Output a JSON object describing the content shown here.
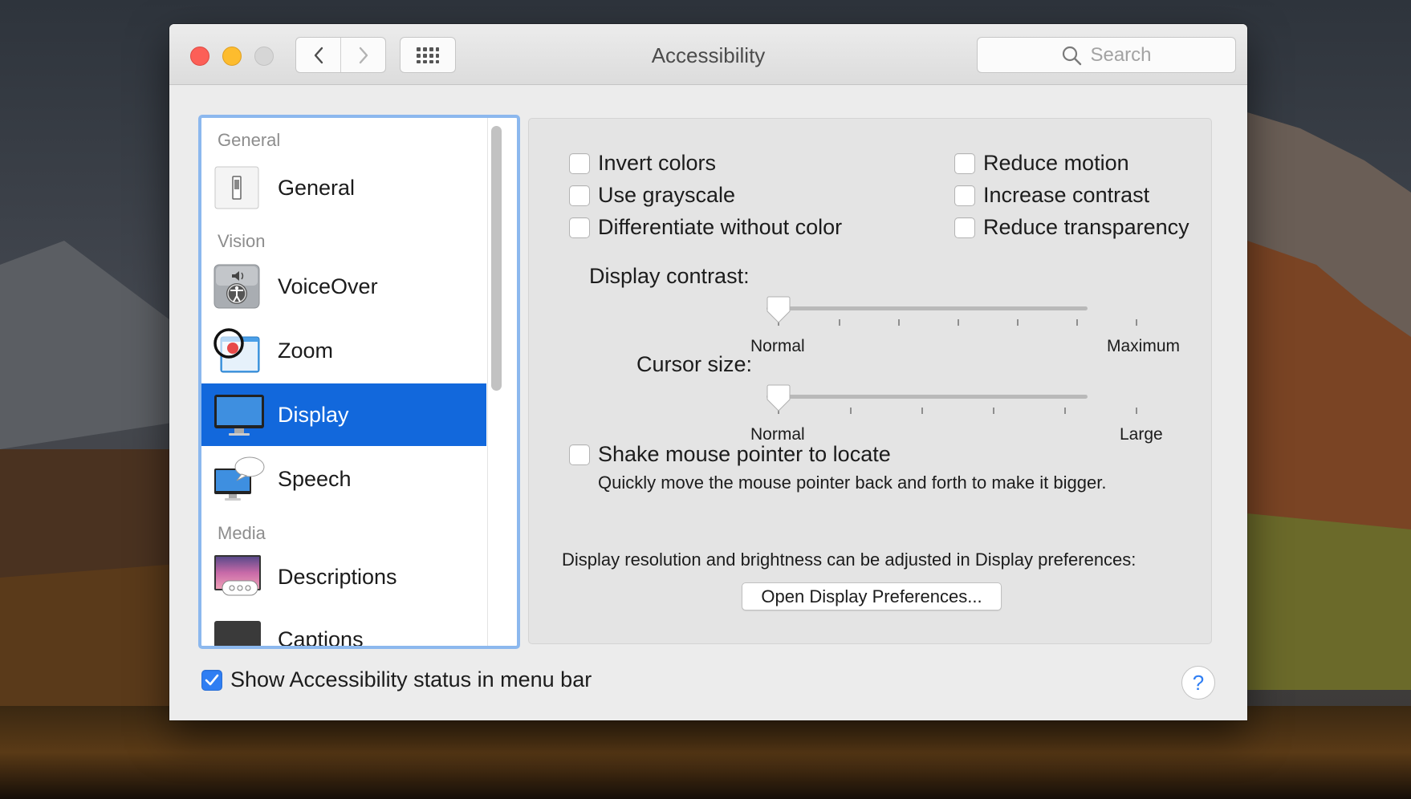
{
  "window": {
    "title": "Accessibility",
    "search_placeholder": "Search"
  },
  "sidebar": {
    "sections": [
      {
        "header": "General",
        "items": [
          {
            "label": "General",
            "icon": "switch-icon"
          }
        ]
      },
      {
        "header": "Vision",
        "items": [
          {
            "label": "VoiceOver",
            "icon": "voiceover-icon"
          },
          {
            "label": "Zoom",
            "icon": "zoom-magnifier-icon"
          },
          {
            "label": "Display",
            "icon": "monitor-icon",
            "selected": true
          },
          {
            "label": "Speech",
            "icon": "speech-bubble-icon"
          }
        ]
      },
      {
        "header": "Media",
        "items": [
          {
            "label": "Descriptions",
            "icon": "descriptions-icon"
          },
          {
            "label": "Captions",
            "icon": "captions-icon"
          }
        ]
      }
    ]
  },
  "display": {
    "options_left": [
      {
        "label": "Invert colors",
        "checked": false
      },
      {
        "label": "Use grayscale",
        "checked": false
      },
      {
        "label": "Differentiate without color",
        "checked": false
      }
    ],
    "options_right": [
      {
        "label": "Reduce motion",
        "checked": false
      },
      {
        "label": "Increase contrast",
        "checked": false
      },
      {
        "label": "Reduce transparency",
        "checked": false
      }
    ],
    "contrast": {
      "label": "Display contrast:",
      "min_label": "Normal",
      "max_label": "Maximum",
      "value": 0
    },
    "cursor": {
      "label": "Cursor size:",
      "min_label": "Normal",
      "max_label": "Large",
      "value": 0
    },
    "shake": {
      "label": "Shake mouse pointer to locate",
      "checked": false,
      "description": "Quickly move the mouse pointer back and forth to make it bigger."
    },
    "note": "Display resolution and brightness can be adjusted in Display preferences:",
    "open_button": "Open Display Preferences..."
  },
  "footer": {
    "show_status_label": "Show Accessibility status in menu bar",
    "show_status_checked": true,
    "help": "?"
  },
  "colors": {
    "accent": "#1268dc",
    "checkbox_checked": "#2f7ef3",
    "close": "#fc5f57",
    "minimize": "#fdbc2e"
  }
}
